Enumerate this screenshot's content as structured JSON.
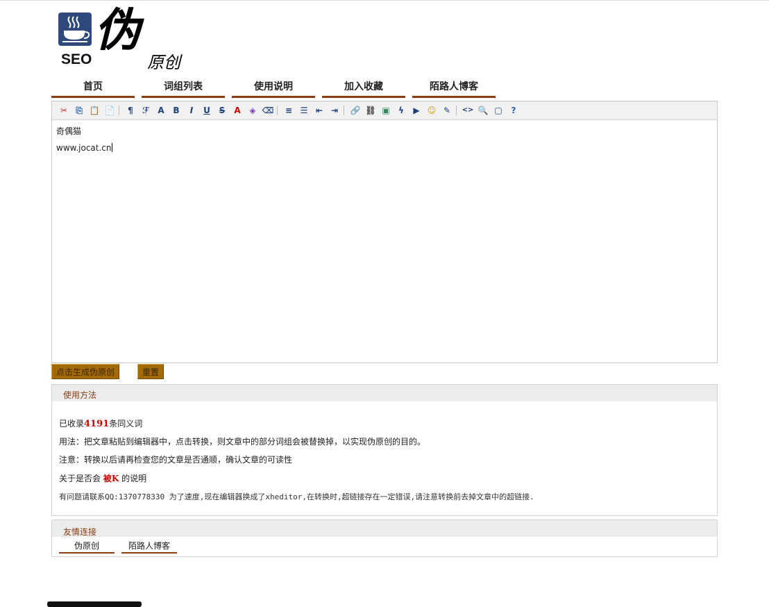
{
  "logo": {
    "seo": "SEO",
    "big_glyph": "伪",
    "small_text": "原创"
  },
  "nav": [
    {
      "label": "首页"
    },
    {
      "label": "词组列表"
    },
    {
      "label": "使用说明"
    },
    {
      "label": "加入收藏"
    },
    {
      "label": "陌路人博客"
    }
  ],
  "toolbar": {
    "buttons": [
      {
        "icon": "cut-icon",
        "glyph": "✂"
      },
      {
        "icon": "copy-icon",
        "glyph": "⎘"
      },
      {
        "icon": "paste-icon",
        "glyph": "📋"
      },
      {
        "icon": "paste-text-icon",
        "glyph": "📄"
      },
      {
        "icon": "block-format-icon",
        "glyph": "¶"
      },
      {
        "icon": "font-family-icon",
        "glyph": "ℱ"
      },
      {
        "icon": "font-size-icon",
        "glyph": "A"
      },
      {
        "icon": "bold-icon",
        "glyph": "B"
      },
      {
        "icon": "italic-icon",
        "glyph": "I"
      },
      {
        "icon": "underline-icon",
        "glyph": "U"
      },
      {
        "icon": "strikethrough-icon",
        "glyph": "S"
      },
      {
        "icon": "font-color-icon",
        "glyph": "A"
      },
      {
        "icon": "highlight-color-icon",
        "glyph": "◈"
      },
      {
        "icon": "remove-format-icon",
        "glyph": "⌫"
      },
      {
        "icon": "align-icon",
        "glyph": "≡"
      },
      {
        "icon": "list-icon",
        "glyph": "☰"
      },
      {
        "icon": "outdent-icon",
        "glyph": "⇤"
      },
      {
        "icon": "indent-icon",
        "glyph": "⇥"
      },
      {
        "icon": "link-icon",
        "glyph": "🔗"
      },
      {
        "icon": "unlink-icon",
        "glyph": "⛓"
      },
      {
        "icon": "image-icon",
        "glyph": "▣"
      },
      {
        "icon": "flash-icon",
        "glyph": "ϟ"
      },
      {
        "icon": "media-icon",
        "glyph": "▶"
      },
      {
        "icon": "emoticon-icon",
        "glyph": "☺"
      },
      {
        "icon": "table-icon",
        "glyph": "✎"
      },
      {
        "icon": "source-icon",
        "glyph": "<>"
      },
      {
        "icon": "preview-icon",
        "glyph": "🔍"
      },
      {
        "icon": "fullscreen-icon",
        "glyph": "▢"
      },
      {
        "icon": "help-icon",
        "glyph": "?"
      }
    ]
  },
  "editor": {
    "lines": [
      "奇偶猫",
      "www.jocat.cn"
    ]
  },
  "buttons": {
    "generate": "点击生成伪原创",
    "reset": "重置"
  },
  "usage": {
    "title": "使用方法",
    "count_prefix": "已收录",
    "count": "4191",
    "count_suffix": "条同义词",
    "line2": "用法：把文章粘贴到编辑器中，点击转换，则文章中的部分词组会被替换掉，以实现伪原创的目的。",
    "line3": "注意：转换以后请再检查您的文章是否通顺，确认文章的可读性",
    "line4_prefix": "关于是否会",
    "line4_link": "被K",
    "line4_suffix": "的说明",
    "line5": "有问题请联系QQ:1370778330 为了速度,现在编辑器换成了xheditor,在转换时,超链接存在一定错误,请注意转换前去掉文章中的超链接."
  },
  "friends": {
    "title": "友情连接",
    "links": [
      {
        "label": "伪原创"
      },
      {
        "label": "陌路人博客"
      }
    ]
  }
}
